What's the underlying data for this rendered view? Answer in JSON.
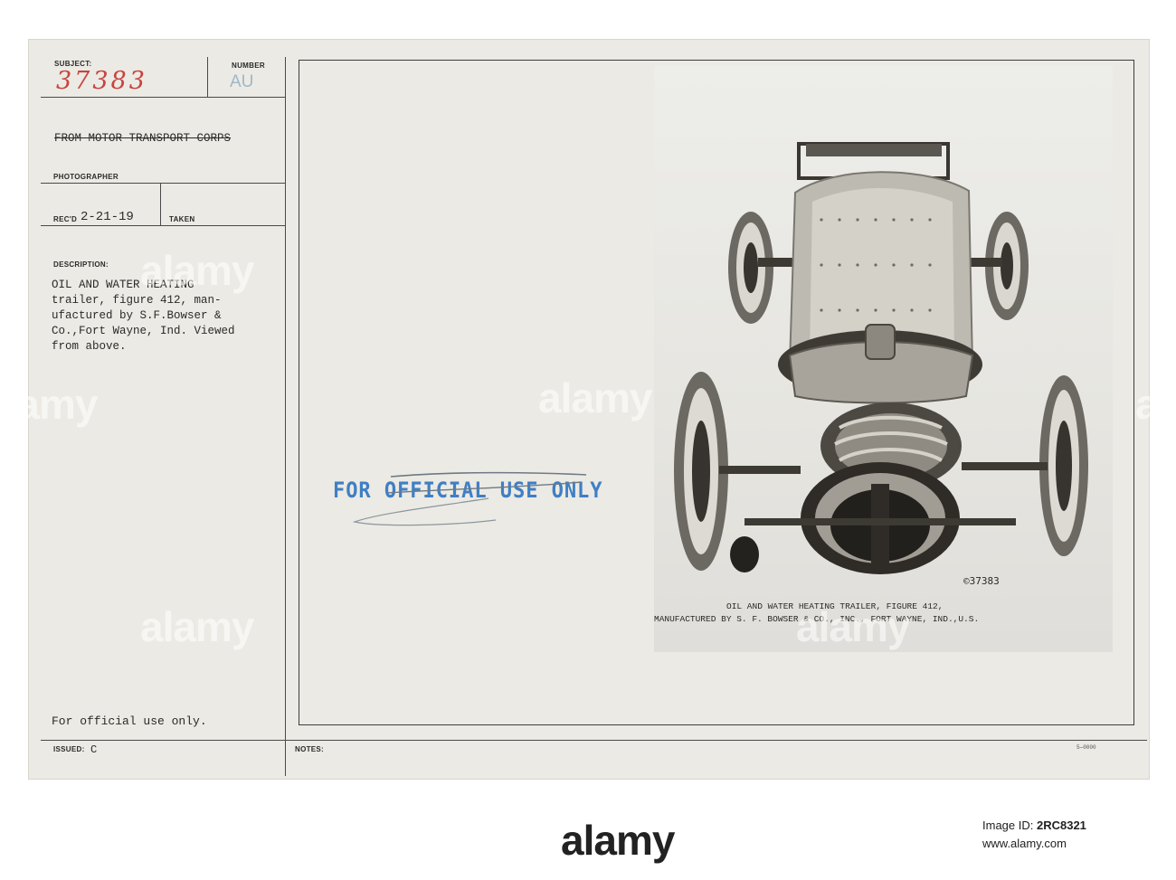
{
  "form": {
    "subject_label": "SUBJECT:",
    "subject_value": "37383",
    "number_label": "NUMBER",
    "number_value": "AU",
    "from": "FROM MOTOR TRANSPORT CORPS",
    "photographer_label": "PHOTOGRAPHER",
    "recd_label": "REC'D",
    "recd_date": "2-21-19",
    "taken_label": "TAKEN",
    "description_label": "DESCRIPTION:",
    "description_lines": [
      "OIL AND WATER HEATING",
      "trailer, figure 412, man-",
      "ufactured by S.F.Bowser &",
      "Co.,Fort Wayne, Ind. Viewed",
      "from above."
    ],
    "official_note": "For official use only.",
    "issued_label": "ISSUED:",
    "issued_value": "C",
    "notes_label": "NOTES:",
    "form_code": "5—0000"
  },
  "stamp": {
    "text": "FOR OFFICIAL USE ONLY",
    "color": "#3f7fc5"
  },
  "photo": {
    "negative_number": "©37383",
    "caption_line1": "OIL AND WATER HEATING TRAILER, FIGURE 412,",
    "caption_line2": "MANUFACTURED BY S. F. BOWSER & CO., INC., FORT WAYNE, IND.,U.S."
  },
  "watermark": {
    "brand": "alamy",
    "image_id_label": "Image ID:",
    "image_id": "2RC8321",
    "site": "www.alamy.com"
  }
}
